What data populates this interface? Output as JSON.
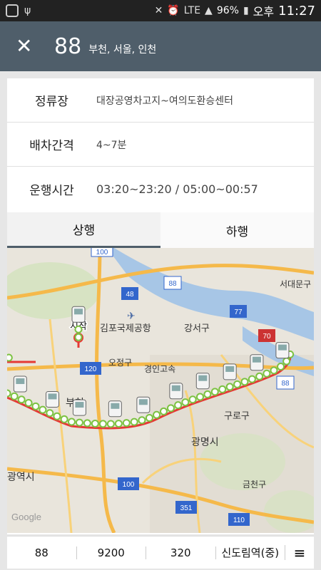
{
  "status_bar": {
    "network": "LTE",
    "battery": "96%",
    "ampm": "오후",
    "time": "11:27"
  },
  "header": {
    "route_number": "88",
    "route_area": "부천, 서울, 인천"
  },
  "info": {
    "stop_label": "정류장",
    "stop_value": "대장공영차고지~여의도환승센터",
    "interval_label": "배차간격",
    "interval_value": "4~7분",
    "hours_label": "운행시간",
    "hours_value": "03:20~23:20 / 05:00~00:57"
  },
  "tabs": {
    "up": "상행",
    "down": "하행"
  },
  "map": {
    "start_label": "시작",
    "places": {
      "gimpo_airport": "김포국제공항",
      "gangseo": "강서구",
      "seodaemun": "서대문구",
      "ojeong": "오정구",
      "gyeongin": "경인고속",
      "guro": "구로구",
      "gwangmyeong": "광명시",
      "geumcheon": "금천구",
      "bucheon": "부천",
      "gwangyeok": "광역시",
      "google": "Google"
    },
    "shields": [
      "100",
      "48",
      "88",
      "77",
      "70",
      "120",
      "88",
      "100",
      "351",
      "110"
    ],
    "route_color": "#e53935",
    "stop_color": "#7cc242"
  },
  "bottom_bar": {
    "items": [
      "88",
      "9200",
      "320",
      "신도림역(중)"
    ],
    "menu_icon": "hamburger-icon"
  }
}
